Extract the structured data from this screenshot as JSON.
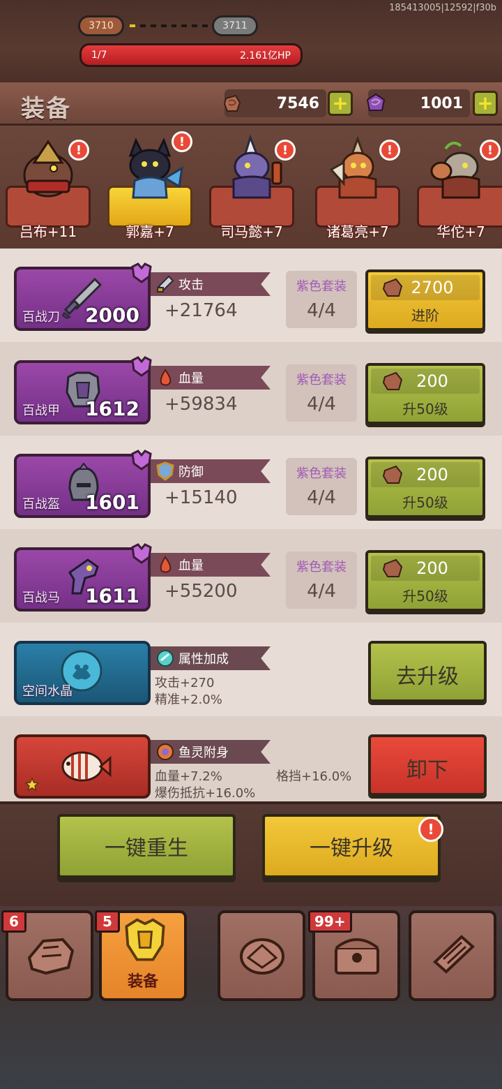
{
  "build_id": "185413005|12592|f30b",
  "stage": {
    "current": "3710",
    "next": "3711",
    "progress_dots": 1,
    "total_dots": 8
  },
  "boss": {
    "wave": "1/7",
    "hp": "2.161亿HP"
  },
  "header": {
    "title": "装备"
  },
  "currencies": {
    "stone": "7546",
    "gem": "1001"
  },
  "heroes": [
    {
      "name": "吕布+11",
      "alert": "!",
      "selected": false
    },
    {
      "name": "郭嘉+7",
      "alert": "!",
      "selected": true
    },
    {
      "name": "司马懿+7",
      "alert": "!",
      "selected": false
    },
    {
      "name": "诸葛亮+7",
      "alert": "!",
      "selected": false
    },
    {
      "name": "华佗+7",
      "alert": "!",
      "selected": false
    }
  ],
  "equipment": [
    {
      "name": "百战刀",
      "power": "2000",
      "stat_label": "攻击",
      "stat_value": "+21764",
      "set_label": "紫色套装",
      "set_value": "4/4",
      "cost": "2700",
      "action": "进阶",
      "style": "yellow"
    },
    {
      "name": "百战甲",
      "power": "1612",
      "stat_label": "血量",
      "stat_value": "+59834",
      "set_label": "紫色套装",
      "set_value": "4/4",
      "cost": "200",
      "action": "升50级",
      "style": "green"
    },
    {
      "name": "百战盔",
      "power": "1601",
      "stat_label": "防御",
      "stat_value": "+15140",
      "set_label": "紫色套装",
      "set_value": "4/4",
      "cost": "200",
      "action": "升50级",
      "style": "green"
    },
    {
      "name": "百战马",
      "power": "1611",
      "stat_label": "血量",
      "stat_value": "+55200",
      "set_label": "紫色套装",
      "set_value": "4/4",
      "cost": "200",
      "action": "升50级",
      "style": "green"
    }
  ],
  "crystal": {
    "name": "空间水晶",
    "stat_label": "属性加成",
    "lines": [
      "攻击+270",
      "精准+2.0%"
    ],
    "action": "去升级"
  },
  "fish": {
    "stat_label": "鱼灵附身",
    "lines": [
      "血量+7.2%",
      "格挡+16.0%",
      "爆伤抵抗+16.0%"
    ],
    "action": "卸下"
  },
  "bottom_actions": {
    "rebirth": "一键重生",
    "upgrade_all": "一键升级",
    "upgrade_alert": "!"
  },
  "tabs": [
    {
      "label": "",
      "badge": "6"
    },
    {
      "label": "装备",
      "badge": "5"
    },
    {
      "label": "",
      "badge": ""
    },
    {
      "label": "",
      "badge": "99+"
    },
    {
      "label": "",
      "badge": ""
    }
  ],
  "colors": {
    "accent_purple": "#a25ab6",
    "green_button": "#9fb03f",
    "yellow_button": "#e8b82a",
    "red_button": "#d63d30"
  }
}
